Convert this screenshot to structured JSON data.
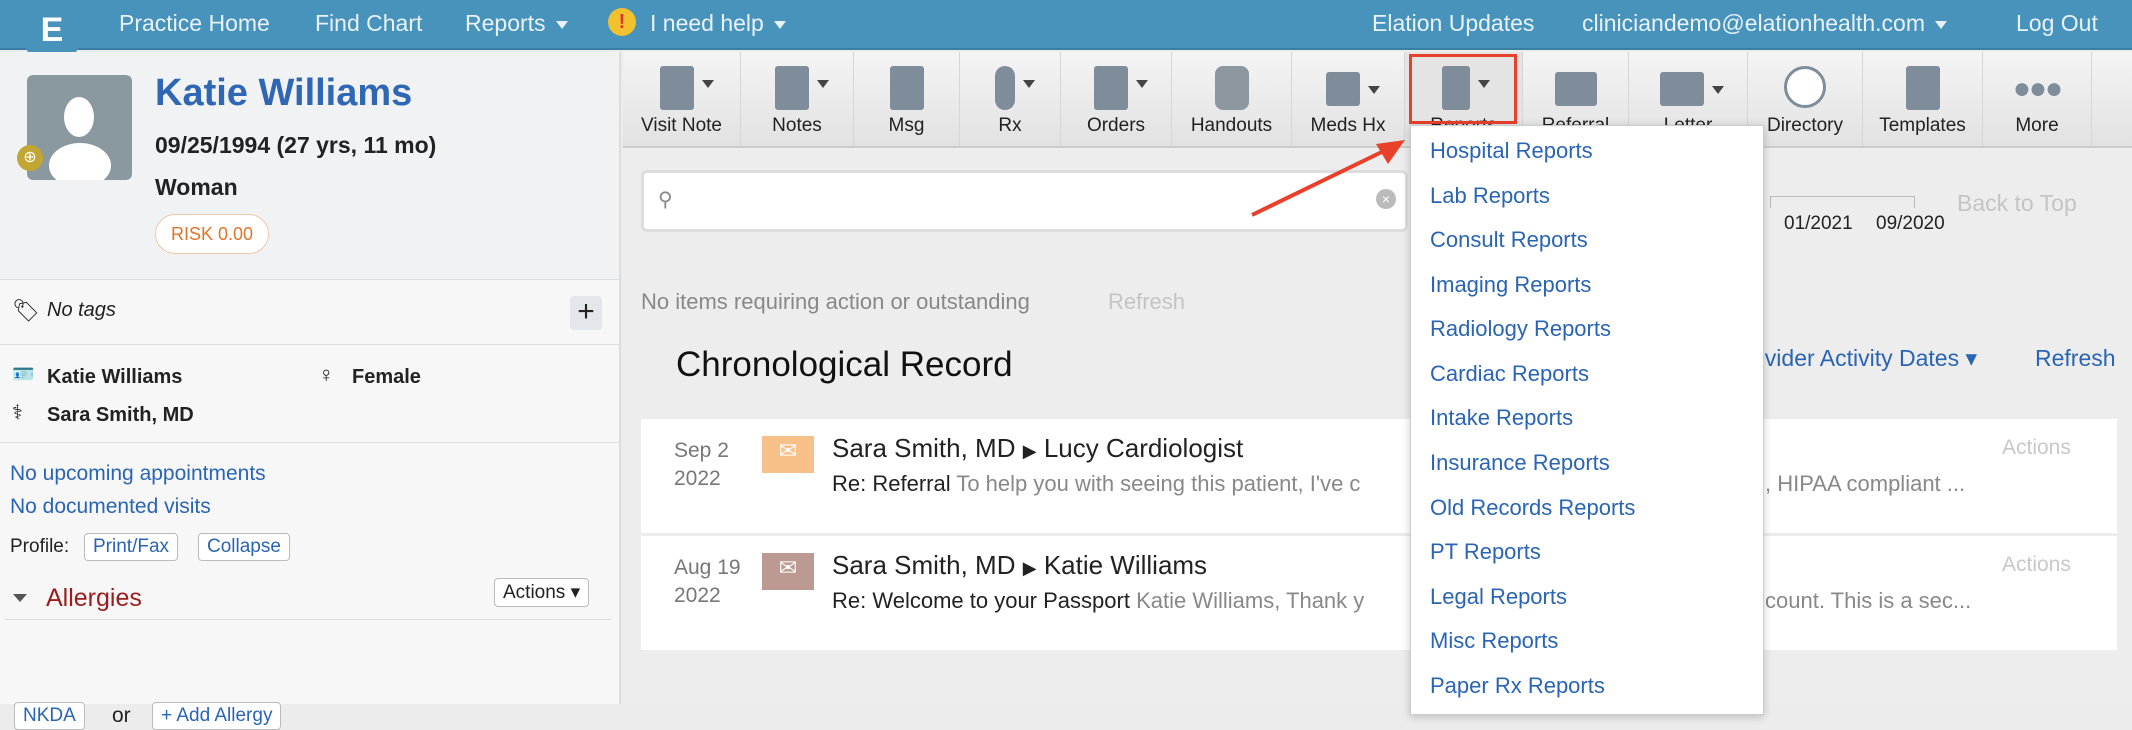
{
  "topnav": {
    "items": [
      "Practice Home",
      "Find Chart",
      "Reports",
      "I need help"
    ],
    "right": [
      "Elation Updates",
      "cliniciandemo@elationhealth.com",
      "Log Out"
    ],
    "logo": "E"
  },
  "patient": {
    "name": "Katie Williams",
    "dob": "09/25/1994 (27 yrs, 11 mo)",
    "gender_identity": "Woman",
    "risk": "RISK 0.00",
    "tags": "No tags",
    "legal_name": "Katie Williams",
    "sex": "Female",
    "provider": "Sara Smith, MD",
    "appointments": "No upcoming appointments",
    "visits": "No documented visits",
    "profile_label": "Profile:",
    "print_fax": "Print/Fax",
    "collapse": "Collapse",
    "allergies": "Allergies",
    "actions": "Actions",
    "nkda": "NKDA",
    "or": "or",
    "add_allergy": "+ Add Allergy"
  },
  "toolbar": [
    "Visit Note",
    "Notes",
    "Msg",
    "Rx",
    "Orders",
    "Handouts",
    "Meds Hx",
    "Reports",
    "Referral",
    "Letter",
    "Directory",
    "Templates",
    "More"
  ],
  "timeline": {
    "dates": [
      "01/2021",
      "09/2020"
    ],
    "back_to_top": "Back to Top"
  },
  "status": {
    "text": "No items requiring action or outstanding",
    "refresh": "Refresh"
  },
  "record": {
    "title": "Chronological Record",
    "sort": "ovider Activity Dates",
    "refresh": "Refresh",
    "entries": [
      {
        "date": "Sep 2",
        "year": "2022",
        "from": "Sara Smith, MD",
        "to": "Lucy Cardiologist",
        "subject": "Re: Referral",
        "preview": "To help you with seeing this patient, I've c",
        "preview_end": ", HIPAA compliant ...",
        "actions": "Actions",
        "color": "#f6c088"
      },
      {
        "date": "Aug 19",
        "year": "2022",
        "from": "Sara Smith, MD",
        "to": "Katie Williams",
        "subject": "Re: Welcome to your Passport",
        "preview": "Katie Williams, Thank y",
        "preview_end": "count. This is a sec...",
        "actions": "Actions",
        "color": "#bc9a92"
      }
    ]
  },
  "reports_menu": [
    "Hospital Reports",
    "Lab Reports",
    "Consult Reports",
    "Imaging Reports",
    "Radiology Reports",
    "Cardiac Reports",
    "Intake Reports",
    "Insurance Reports",
    "Old Records Reports",
    "PT Reports",
    "Legal Reports",
    "Misc Reports",
    "Paper Rx Reports"
  ],
  "colors": {
    "topbar": "#4893bb",
    "link": "#2a64b4",
    "highlight": "#e8402a",
    "allergies": "#9b1c1c"
  }
}
